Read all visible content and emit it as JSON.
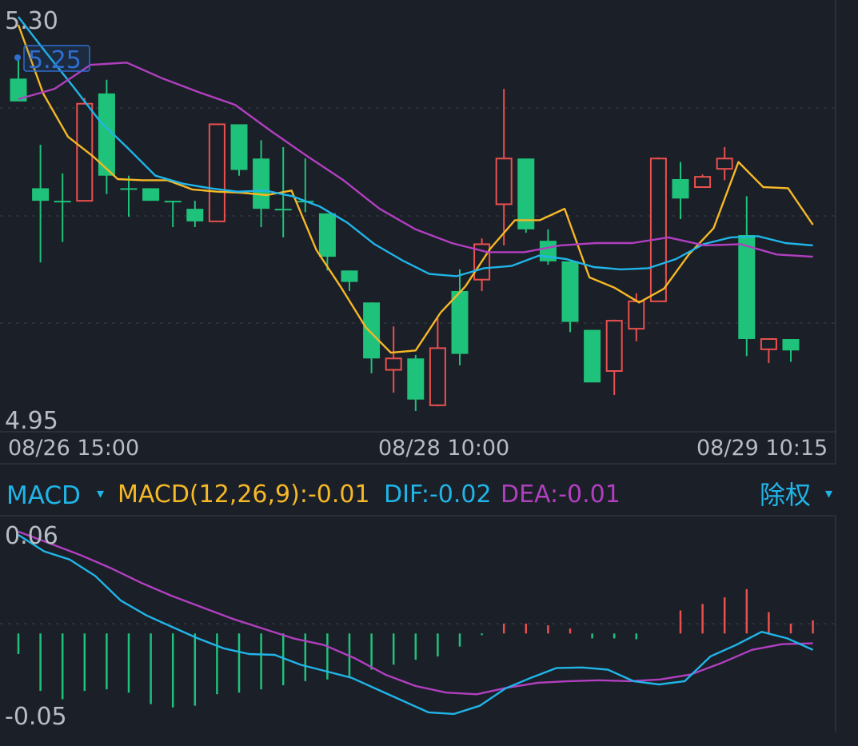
{
  "colors": {
    "background": "#1b1f27",
    "up": "#e9504f",
    "down": "#1fc27a",
    "ma1": "#f5b826",
    "ma2": "#20b5e8",
    "ma3": "#b13fc0",
    "grid": "#3a3f4a",
    "axis_text": "#b8bcc4",
    "macd_label": "#20b5e8",
    "macd_value": "#f5b826",
    "dif": "#20b5e8",
    "dea": "#b13fc0",
    "badge_border": "#2f6fd0",
    "badge_text": "#2f6fd0"
  },
  "price_panel": {
    "y_max_label": "5.30",
    "y_min_label": "4.95",
    "badge_value": "5.25",
    "x_labels": [
      "08/26 15:00",
      "08/28 10:00",
      "08/29 10:15"
    ]
  },
  "indicator_bar": {
    "selector_label": "MACD",
    "selector_arrow": "▾",
    "macd_text": "MACD(12,26,9):-0.01",
    "dif_text": "DIF:-0.02",
    "dea_text": "DEA:-0.01",
    "adjust_label": "除权",
    "adjust_arrow": "▾"
  },
  "macd_panel": {
    "y_max_label": "0.06",
    "y_min_label": "-0.05"
  },
  "chart_data": [
    {
      "type": "candlestick",
      "ylim": [
        4.95,
        5.3
      ],
      "x_tick_labels": [
        "08/26 15:00",
        "08/28 10:00",
        "08/29 10:15"
      ],
      "candles": [
        {
          "o": 5.248,
          "h": 5.264,
          "l": 5.237,
          "c": 5.228
        },
        {
          "o": 5.152,
          "h": 5.19,
          "l": 5.087,
          "c": 5.141
        },
        {
          "o": 5.141,
          "h": 5.165,
          "l": 5.105,
          "c": 5.141
        },
        {
          "o": 5.141,
          "h": 5.231,
          "l": 5.141,
          "c": 5.226
        },
        {
          "o": 5.235,
          "h": 5.247,
          "l": 5.147,
          "c": 5.163
        },
        {
          "o": 5.152,
          "h": 5.163,
          "l": 5.127,
          "c": 5.152
        },
        {
          "o": 5.152,
          "h": 5.152,
          "l": 5.141,
          "c": 5.141
        },
        {
          "o": 5.141,
          "h": 5.141,
          "l": 5.118,
          "c": 5.141
        },
        {
          "o": 5.134,
          "h": 5.141,
          "l": 5.118,
          "c": 5.123
        },
        {
          "o": 5.123,
          "h": 5.208,
          "l": 5.123,
          "c": 5.208
        },
        {
          "o": 5.208,
          "h": 5.208,
          "l": 5.163,
          "c": 5.168
        },
        {
          "o": 5.178,
          "h": 5.194,
          "l": 5.118,
          "c": 5.134
        },
        {
          "o": 5.134,
          "h": 5.188,
          "l": 5.109,
          "c": 5.134
        },
        {
          "o": 5.141,
          "h": 5.178,
          "l": 5.131,
          "c": 5.141
        },
        {
          "o": 5.13,
          "h": 5.13,
          "l": 5.08,
          "c": 5.092
        },
        {
          "o": 5.08,
          "h": 5.08,
          "l": 5.062,
          "c": 5.07
        },
        {
          "o": 5.052,
          "h": 5.052,
          "l": 4.99,
          "c": 5.003
        },
        {
          "o": 4.993,
          "h": 5.031,
          "l": 4.973,
          "c": 5.003
        },
        {
          "o": 5.003,
          "h": 5.006,
          "l": 4.957,
          "c": 4.967
        },
        {
          "o": 4.962,
          "h": 5.038,
          "l": 4.961,
          "c": 5.012
        },
        {
          "o": 5.062,
          "h": 5.081,
          "l": 4.997,
          "c": 5.007
        },
        {
          "o": 5.072,
          "h": 5.108,
          "l": 5.062,
          "c": 5.103
        },
        {
          "o": 5.138,
          "h": 5.239,
          "l": 5.102,
          "c": 5.178
        },
        {
          "o": 5.178,
          "h": 5.178,
          "l": 5.113,
          "c": 5.116
        },
        {
          "o": 5.106,
          "h": 5.116,
          "l": 5.085,
          "c": 5.088
        },
        {
          "o": 5.088,
          "h": 5.088,
          "l": 5.026,
          "c": 5.035
        },
        {
          "o": 5.028,
          "h": 5.028,
          "l": 4.983,
          "c": 4.982
        },
        {
          "o": 4.992,
          "h": 5.037,
          "l": 4.971,
          "c": 5.036
        },
        {
          "o": 5.029,
          "h": 5.06,
          "l": 5.018,
          "c": 5.053
        },
        {
          "o": 5.053,
          "h": 5.179,
          "l": 5.053,
          "c": 5.178
        },
        {
          "o": 5.16,
          "h": 5.175,
          "l": 5.125,
          "c": 5.143
        },
        {
          "o": 5.153,
          "h": 5.164,
          "l": 5.153,
          "c": 5.162
        },
        {
          "o": 5.169,
          "h": 5.188,
          "l": 5.159,
          "c": 5.178
        },
        {
          "o": 5.111,
          "h": 5.145,
          "l": 5.005,
          "c": 5.02
        },
        {
          "o": 5.011,
          "h": 5.02,
          "l": 4.999,
          "c": 5.02
        },
        {
          "o": 5.02,
          "h": 5.02,
          "l": 5.0,
          "c": 5.01
        }
      ],
      "ma_lines": [
        {
          "values": [
            5.295,
            5.235,
            5.197,
            5.18,
            5.16,
            5.159,
            5.159,
            5.151,
            5.149,
            5.148,
            5.146,
            5.15,
            5.098,
            5.065,
            5.03,
            5.008,
            5.01,
            5.043,
            5.066,
            5.099,
            5.124,
            5.124,
            5.134,
            5.074,
            5.065,
            5.052,
            5.064,
            5.094,
            5.117,
            5.175,
            5.153,
            5.152,
            5.12
          ]
        },
        {
          "values": [
            5.302,
            5.271,
            5.241,
            5.21,
            5.187,
            5.163,
            5.156,
            5.152,
            5.149,
            5.15,
            5.145,
            5.136,
            5.122,
            5.103,
            5.089,
            5.077,
            5.075,
            5.082,
            5.084,
            5.093,
            5.09,
            5.083,
            5.081,
            5.082,
            5.09,
            5.103,
            5.109,
            5.11,
            5.104,
            5.102
          ]
        },
        {
          "values": [
            5.23,
            5.239,
            5.26,
            5.262,
            5.248,
            5.236,
            5.225,
            5.202,
            5.18,
            5.159,
            5.134,
            5.116,
            5.104,
            5.096,
            5.096,
            5.102,
            5.104,
            5.104,
            5.109,
            5.102,
            5.103,
            5.094,
            5.092
          ]
        }
      ]
    },
    {
      "type": "macd",
      "ylim": [
        -0.05,
        0.06
      ],
      "histogram": [
        -0.0125,
        -0.035,
        -0.04,
        -0.035,
        -0.034,
        -0.036,
        -0.043,
        -0.045,
        -0.044,
        -0.037,
        -0.036,
        -0.034,
        -0.0315,
        -0.029,
        -0.028,
        -0.026,
        -0.022,
        -0.019,
        -0.016,
        -0.014,
        -0.008,
        -0.001,
        0.006,
        0.006,
        0.005,
        0.003,
        -0.003,
        -0.003,
        -0.0035,
        0.0,
        0.014,
        0.018,
        0.022,
        0.027,
        0.013,
        0.006,
        0.008
      ],
      "dif": [
        0.06,
        0.05,
        0.045,
        0.035,
        0.02,
        0.011,
        0.004,
        -0.003,
        -0.009,
        -0.0125,
        -0.013,
        -0.019,
        -0.023,
        -0.027,
        -0.034,
        -0.041,
        -0.048,
        -0.049,
        -0.044,
        -0.0335,
        -0.027,
        -0.021,
        -0.0207,
        -0.022,
        -0.029,
        -0.031,
        -0.029,
        -0.014,
        -0.007,
        0.001,
        -0.003,
        -0.01
      ],
      "dea": [
        0.062,
        0.055,
        0.048,
        0.04,
        0.031,
        0.023,
        0.016,
        0.009,
        0.003,
        -0.003,
        -0.007,
        -0.015,
        -0.025,
        -0.032,
        -0.036,
        -0.037,
        -0.033,
        -0.03,
        -0.029,
        -0.0285,
        -0.029,
        -0.028,
        -0.025,
        -0.018,
        -0.01,
        -0.0065,
        -0.006
      ]
    }
  ]
}
